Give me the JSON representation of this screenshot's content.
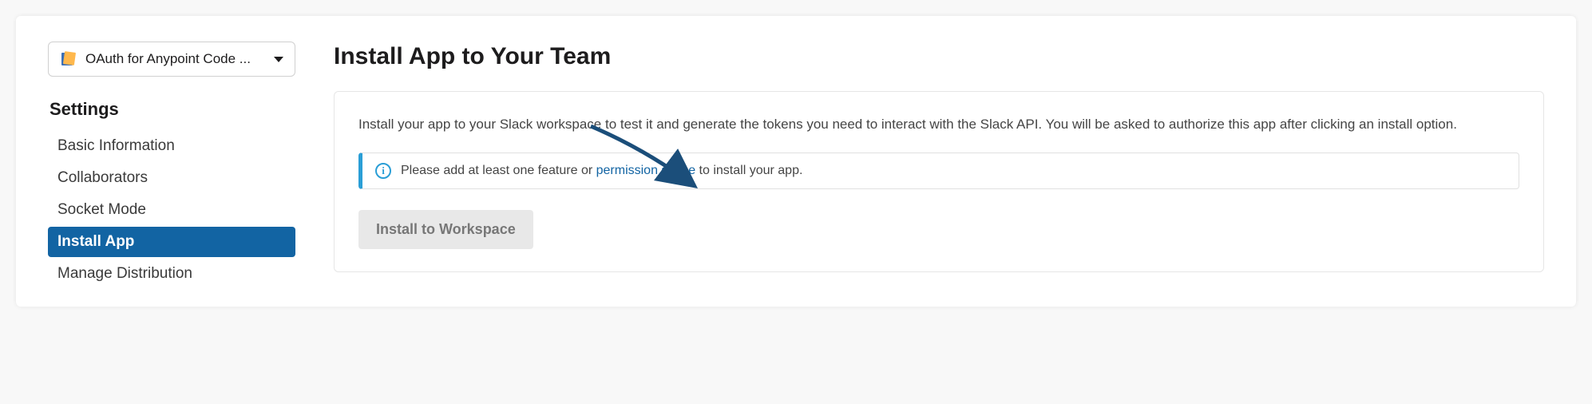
{
  "sidebar": {
    "app_name": "OAuth for Anypoint Code ...",
    "section_title": "Settings",
    "items": [
      {
        "label": "Basic Information",
        "active": false
      },
      {
        "label": "Collaborators",
        "active": false
      },
      {
        "label": "Socket Mode",
        "active": false
      },
      {
        "label": "Install App",
        "active": true
      },
      {
        "label": "Manage Distribution",
        "active": false
      }
    ]
  },
  "main": {
    "title": "Install App to Your Team",
    "description": "Install your app to your Slack workspace to test it and generate the tokens you need to interact with the Slack API. You will be asked to authorize this app after clicking an install option.",
    "info_prefix": "Please add at least one feature or ",
    "info_link": "permission scope",
    "info_suffix": " to install your app.",
    "install_button": "Install to Workspace"
  }
}
